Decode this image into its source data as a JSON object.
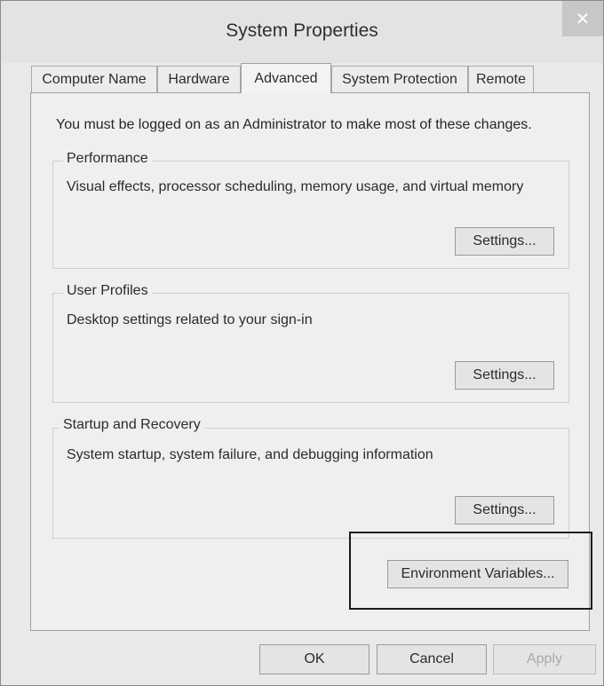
{
  "window": {
    "title": "System Properties",
    "close_glyph": "✕"
  },
  "tabs": [
    {
      "label": "Computer Name"
    },
    {
      "label": "Hardware"
    },
    {
      "label": "Advanced"
    },
    {
      "label": "System Protection"
    },
    {
      "label": "Remote"
    }
  ],
  "active_tab": "Advanced",
  "notice": "You must be logged on as an Administrator to make most of these changes.",
  "groups": {
    "performance": {
      "title": "Performance",
      "description": "Visual effects, processor scheduling, memory usage, and virtual memory",
      "button": "Settings..."
    },
    "user_profiles": {
      "title": "User Profiles",
      "description": "Desktop settings related to your sign-in",
      "button": "Settings..."
    },
    "startup": {
      "title": "Startup and Recovery",
      "description": "System startup, system failure, and debugging information",
      "button": "Settings..."
    }
  },
  "env_button": "Environment Variables...",
  "footer": {
    "ok": "OK",
    "cancel": "Cancel",
    "apply": "Apply"
  },
  "colors": {
    "dialog_bg": "#e9e9e9",
    "panel_bg": "#efefef",
    "highlight": "#1a1a1a"
  }
}
